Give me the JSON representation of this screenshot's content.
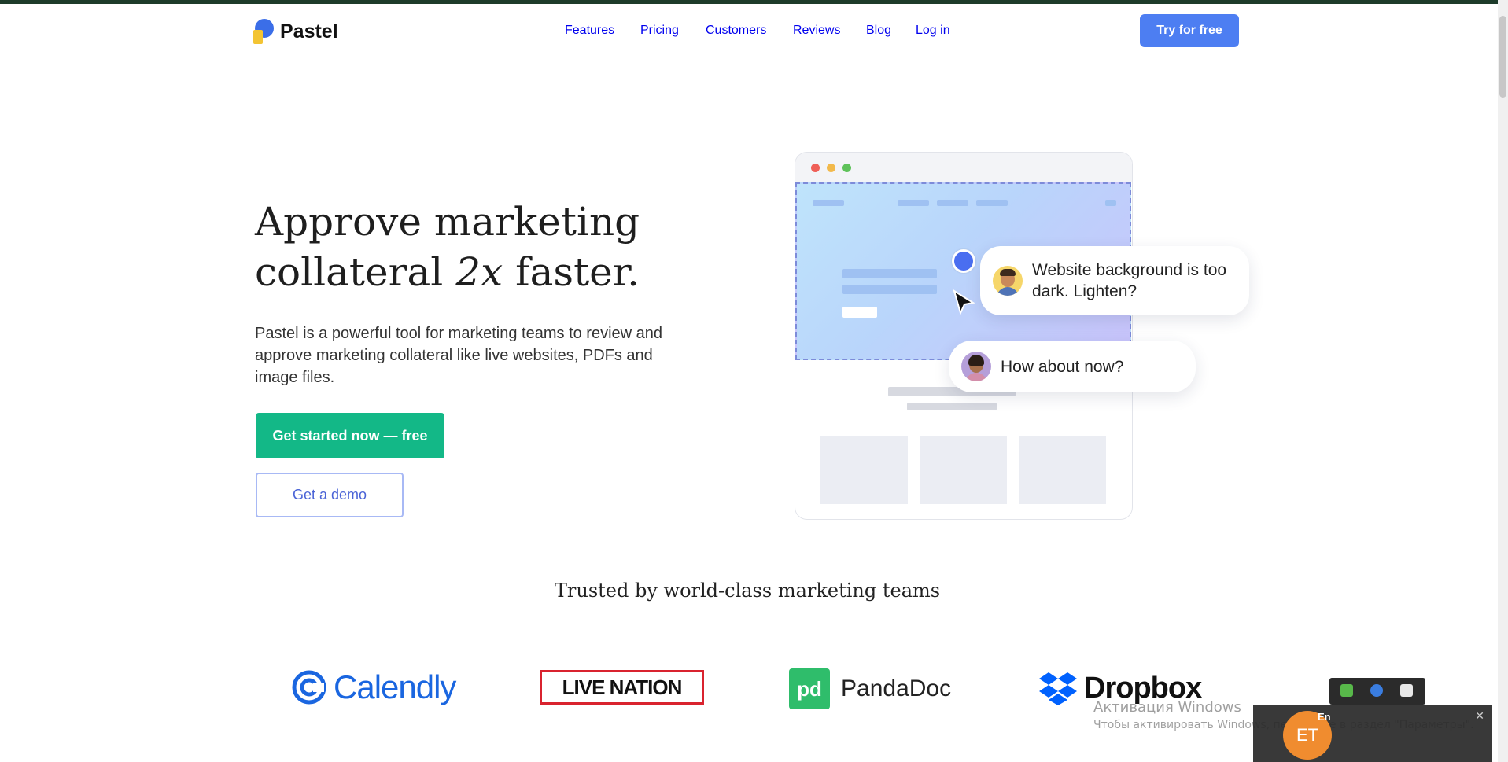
{
  "header": {
    "logo": "Pastel",
    "nav": [
      "Features",
      "Pricing",
      "Customers",
      "Reviews",
      "Blog",
      "Log in"
    ],
    "cta": "Try for free"
  },
  "hero": {
    "title_line1": "Approve marketing",
    "title_line2_pre": "collateral ",
    "title_line2_em": "2x",
    "title_line2_post": " faster.",
    "description": "Pastel is a powerful tool for marketing teams to review and approve marketing collateral like live websites, PDFs and image files.",
    "primary_button": "Get started now — free",
    "secondary_button": "Get a demo"
  },
  "illustration": {
    "comment1": "Website background is too dark. Lighten?",
    "comment2": "How about now?"
  },
  "trusted": {
    "heading": "Trusted by world-class marketing teams",
    "logos": [
      "Calendly",
      "LIVE NATION",
      "PandaDoc",
      "Dropbox"
    ]
  },
  "system": {
    "activation_title": "Активация Windows",
    "activation_text": "Чтобы активировать Windows, перейдите в раздел \"Параметры\".",
    "toast_initials": "ET",
    "toast_name": "En"
  },
  "colors": {
    "accent": "#4d7ef2",
    "primary_green": "#13b887",
    "calendly_blue": "#1a66e0",
    "livenation_red": "#d9232f",
    "pandadoc_green": "#2fbd6b"
  }
}
